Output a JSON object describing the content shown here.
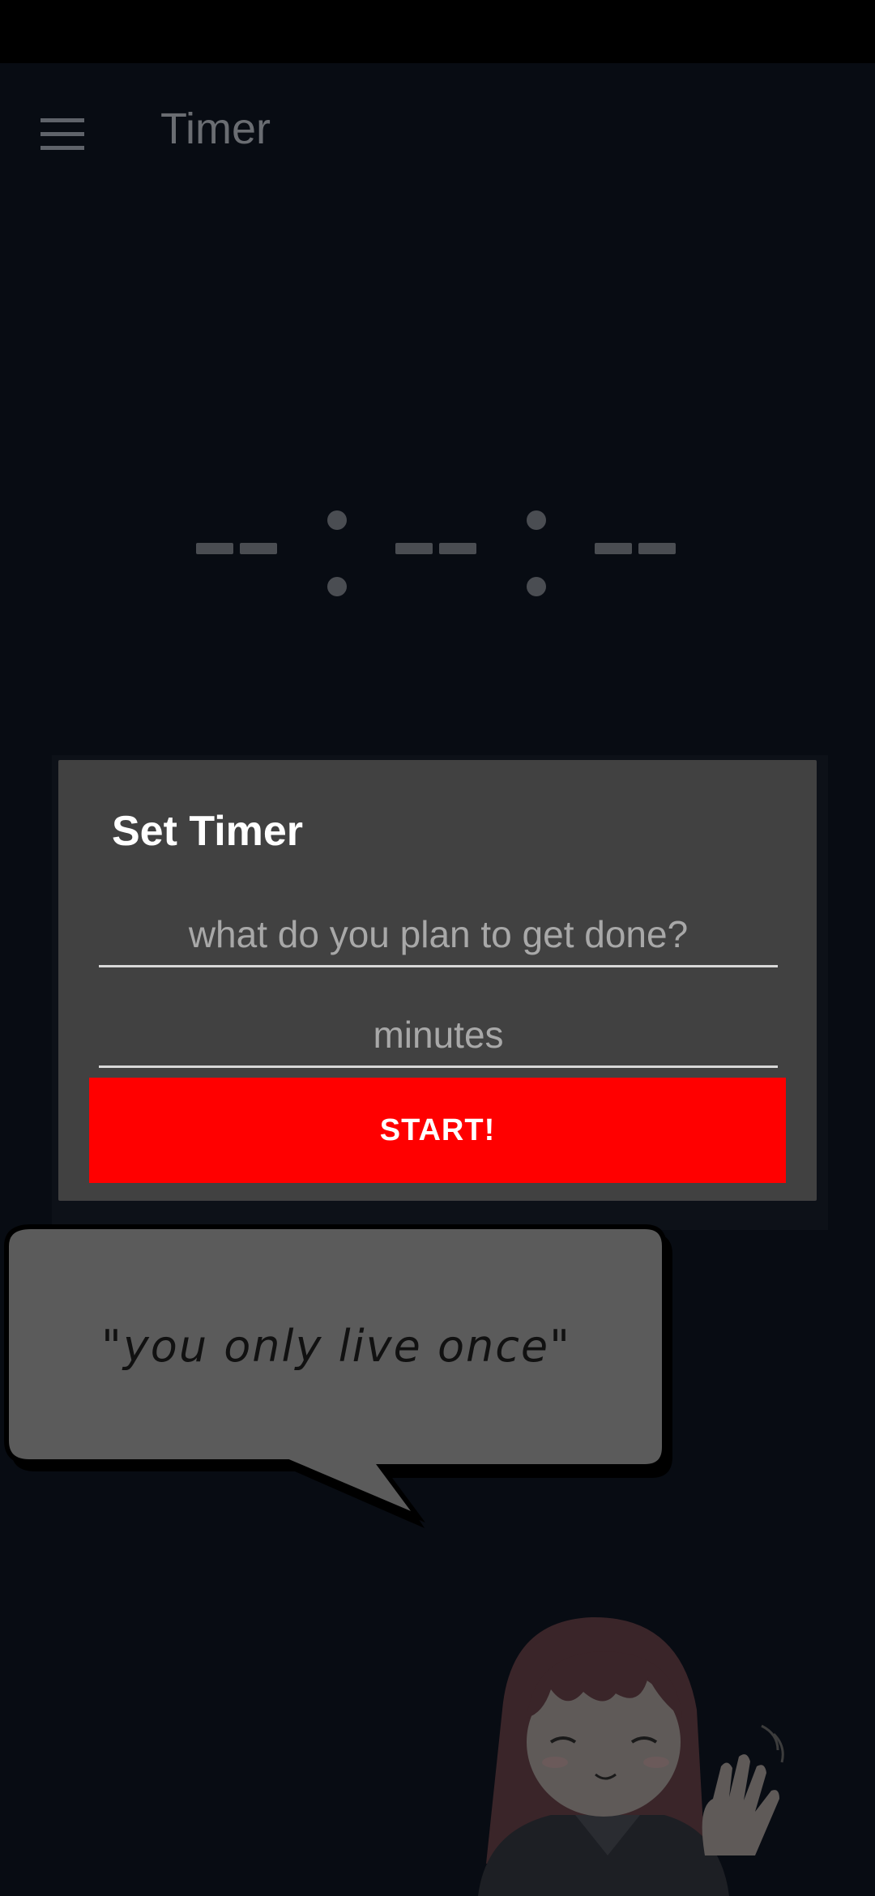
{
  "app_bar": {
    "menu_icon": "hamburger-menu-icon",
    "title": "Timer"
  },
  "countdown": {
    "hours": "--",
    "minutes": "--",
    "seconds": "--"
  },
  "dialog": {
    "title": "Set Timer",
    "task_placeholder": "what do you plan to get done?",
    "task_value": "",
    "minutes_placeholder": "minutes",
    "minutes_value": "",
    "start_label": "START!",
    "start_color": "#ff0000"
  },
  "speech_bubble": {
    "quote": "\"you only live once\""
  },
  "mascot": {
    "icon": "waving-girl-illustration"
  },
  "colors": {
    "background": "#080c13",
    "dialog": "#414141",
    "accent": "#ff0000"
  }
}
